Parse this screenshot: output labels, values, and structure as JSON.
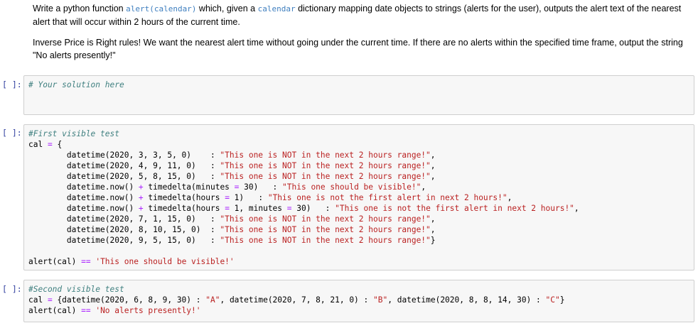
{
  "markdown": {
    "p1": {
      "part1": "Write a python function ",
      "code1": "alert(calendar)",
      "part2": " which, given a ",
      "code2": "calendar",
      "part3": " dictionary mapping date objects to strings (alerts for the user), outputs the alert text of the nearest alert that will occur within 2 hours of the current time."
    },
    "p2": "Inverse Price is Right rules! We want the nearest alert time without going under the current time. If there are no alerts within the specified time frame, output the string \"No alerts presently!\""
  },
  "cells": [
    {
      "prompt": "[ ]:",
      "lines": [
        [
          {
            "t": "# Your solution here",
            "c": "cm"
          }
        ]
      ]
    },
    {
      "prompt": "[ ]:",
      "lines": [
        [
          {
            "t": "#First visible test",
            "c": "cm"
          }
        ],
        [
          {
            "t": "cal ",
            "c": "pl"
          },
          {
            "t": "=",
            "c": "op"
          },
          {
            "t": " {",
            "c": "pl"
          }
        ],
        [
          {
            "t": "        datetime(2020, 3, 3, 5, 0)    : ",
            "c": "pl"
          },
          {
            "t": "\"This one is NOT in the next 2 hours range!\"",
            "c": "st"
          },
          {
            "t": ",",
            "c": "pl"
          }
        ],
        [
          {
            "t": "        datetime(2020, 4, 9, 11, 0)   : ",
            "c": "pl"
          },
          {
            "t": "\"This one is NOT in the next 2 hours range!\"",
            "c": "st"
          },
          {
            "t": ",",
            "c": "pl"
          }
        ],
        [
          {
            "t": "        datetime(2020, 5, 8, 15, 0)   : ",
            "c": "pl"
          },
          {
            "t": "\"This one is NOT in the next 2 hours range!\"",
            "c": "st"
          },
          {
            "t": ",",
            "c": "pl"
          }
        ],
        [
          {
            "t": "        datetime.now() ",
            "c": "pl"
          },
          {
            "t": "+",
            "c": "op"
          },
          {
            "t": " timedelta(minutes ",
            "c": "pl"
          },
          {
            "t": "=",
            "c": "op"
          },
          {
            "t": " 30)   : ",
            "c": "pl"
          },
          {
            "t": "\"This one should be visible!\"",
            "c": "st"
          },
          {
            "t": ",",
            "c": "pl"
          }
        ],
        [
          {
            "t": "        datetime.now() ",
            "c": "pl"
          },
          {
            "t": "+",
            "c": "op"
          },
          {
            "t": " timedelta(hours ",
            "c": "pl"
          },
          {
            "t": "=",
            "c": "op"
          },
          {
            "t": " 1)   : ",
            "c": "pl"
          },
          {
            "t": "\"This one is not the first alert in next 2 hours!\"",
            "c": "st"
          },
          {
            "t": ",",
            "c": "pl"
          }
        ],
        [
          {
            "t": "        datetime.now() ",
            "c": "pl"
          },
          {
            "t": "+",
            "c": "op"
          },
          {
            "t": " timedelta(hours ",
            "c": "pl"
          },
          {
            "t": "=",
            "c": "op"
          },
          {
            "t": " 1, minutes ",
            "c": "pl"
          },
          {
            "t": "=",
            "c": "op"
          },
          {
            "t": " 30)   : ",
            "c": "pl"
          },
          {
            "t": "\"This one is not the first alert in next 2 hours!\"",
            "c": "st"
          },
          {
            "t": ",",
            "c": "pl"
          }
        ],
        [
          {
            "t": "        datetime(2020, 7, 1, 15, 0)   : ",
            "c": "pl"
          },
          {
            "t": "\"This one is NOT in the next 2 hours range!\"",
            "c": "st"
          },
          {
            "t": ",",
            "c": "pl"
          }
        ],
        [
          {
            "t": "        datetime(2020, 8, 10, 15, 0)  : ",
            "c": "pl"
          },
          {
            "t": "\"This one is NOT in the next 2 hours range!\"",
            "c": "st"
          },
          {
            "t": ",",
            "c": "pl"
          }
        ],
        [
          {
            "t": "        datetime(2020, 9, 5, 15, 0)   : ",
            "c": "pl"
          },
          {
            "t": "\"This one is NOT in the next 2 hours range!\"",
            "c": "st"
          },
          {
            "t": "}",
            "c": "pl"
          }
        ],
        [
          {
            "t": "",
            "c": "pl"
          }
        ],
        [
          {
            "t": "alert(cal) ",
            "c": "pl"
          },
          {
            "t": "==",
            "c": "op"
          },
          {
            "t": " ",
            "c": "pl"
          },
          {
            "t": "'This one should be visible!'",
            "c": "st"
          }
        ]
      ]
    },
    {
      "prompt": "[ ]:",
      "lines": [
        [
          {
            "t": "#Second visible test",
            "c": "cm"
          }
        ],
        [
          {
            "t": "cal ",
            "c": "pl"
          },
          {
            "t": "=",
            "c": "op"
          },
          {
            "t": " {datetime(2020, 6, 8, 9, 30) : ",
            "c": "pl"
          },
          {
            "t": "\"A\"",
            "c": "st"
          },
          {
            "t": ", datetime(2020, 7, 8, 21, 0) : ",
            "c": "pl"
          },
          {
            "t": "\"B\"",
            "c": "st"
          },
          {
            "t": ", datetime(2020, 8, 8, 14, 30) : ",
            "c": "pl"
          },
          {
            "t": "\"C\"",
            "c": "st"
          },
          {
            "t": "}",
            "c": "pl"
          }
        ],
        [
          {
            "t": "alert(cal) ",
            "c": "pl"
          },
          {
            "t": "==",
            "c": "op"
          },
          {
            "t": " ",
            "c": "pl"
          },
          {
            "t": "'No alerts presently!'",
            "c": "st"
          }
        ]
      ]
    }
  ]
}
